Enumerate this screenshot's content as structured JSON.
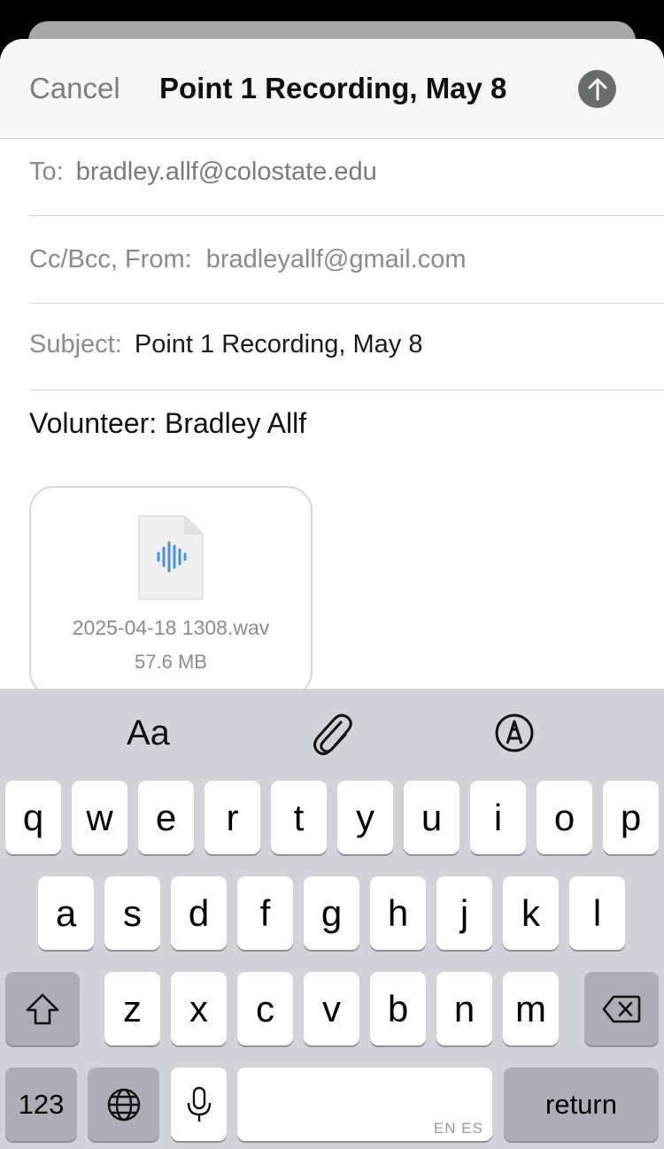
{
  "compose": {
    "cancel_label": "Cancel",
    "title": "Point 1 Recording, May 8",
    "send_icon": "arrow-up-icon",
    "to_label": "To:",
    "to_value": "bradley.allf@colostate.edu",
    "ccbcc_label": "Cc/Bcc, From:",
    "from_value": "bradleyallf@gmail.com",
    "subject_label": "Subject:",
    "subject_value": "Point 1 Recording, May 8",
    "body": "Volunteer: Bradley Allf"
  },
  "attachment": {
    "icon": "audio-file-icon",
    "filename": "2025-04-18 1308.wav",
    "size": "57.6 MB"
  },
  "keyboard": {
    "toolbar": {
      "format_label": "Aa",
      "attach_icon": "paperclip-icon",
      "markup_icon": "markup-pen-icon"
    },
    "row1": [
      "q",
      "w",
      "e",
      "r",
      "t",
      "y",
      "u",
      "i",
      "o",
      "p"
    ],
    "row2": [
      "a",
      "s",
      "d",
      "f",
      "g",
      "h",
      "j",
      "k",
      "l"
    ],
    "row3": [
      "z",
      "x",
      "c",
      "v",
      "b",
      "n",
      "m"
    ],
    "numbers_label": "123",
    "space_lang": "EN ES",
    "return_label": "return"
  },
  "colors": {
    "keyboard_bg": "#d1d3d9",
    "key_bg": "#ffffff",
    "dark_key_bg": "#abaeb6",
    "send_button": "#686c6b",
    "audio_accent": "#4a8fe0"
  }
}
